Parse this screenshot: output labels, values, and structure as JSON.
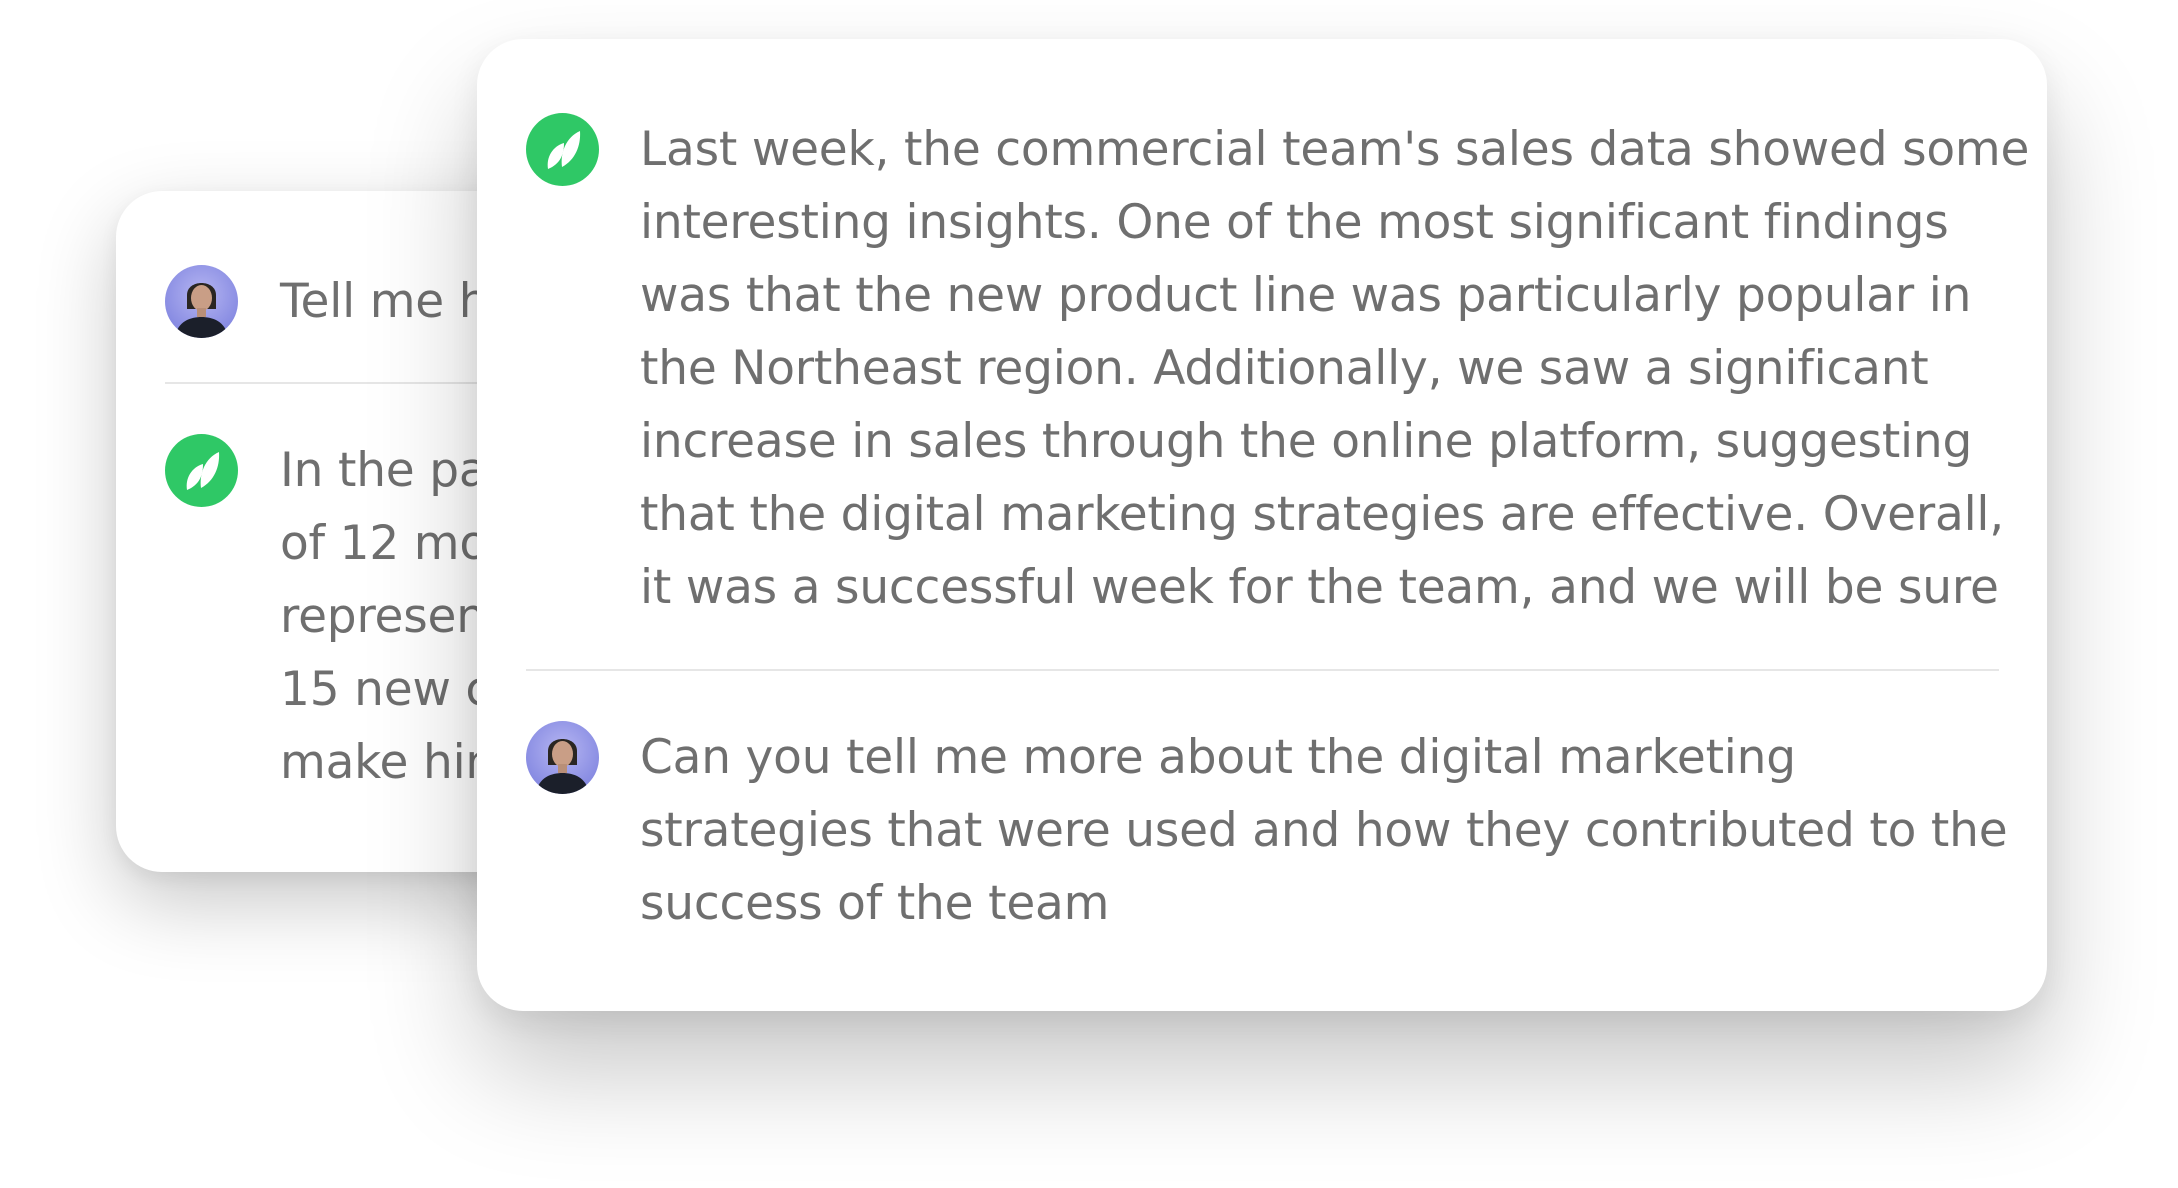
{
  "back_card": {
    "user_message": {
      "avatar": "user-avatar",
      "text": "Tell me h"
    },
    "assistant_message": {
      "icon": "leaf-logo-icon",
      "lines": [
        "In the pa",
        "of 12 mo",
        "represen",
        "15 new c",
        "make hin"
      ]
    }
  },
  "front_card": {
    "assistant_message": {
      "icon": "leaf-logo-icon",
      "lines": [
        "Last week, the commercial team's sales data showed some",
        "interesting insights. One of the most significant findings",
        "was that the new product line was particularly popular in",
        "the Northeast region. Additionally, we saw a significant",
        "increase in sales through the online platform, suggesting",
        "that the digital marketing strategies are effective. Overall,",
        "it was a successful week for the team, and we will be sure"
      ]
    },
    "user_message": {
      "avatar": "user-avatar",
      "lines": [
        "Can you tell me more about the digital marketing",
        "strategies that were used and how they contributed to the",
        "success of the team"
      ]
    }
  },
  "colors": {
    "brand_green": "#2fc866",
    "text_gray": "#6f6f6f",
    "divider": "#e6e6e6"
  }
}
